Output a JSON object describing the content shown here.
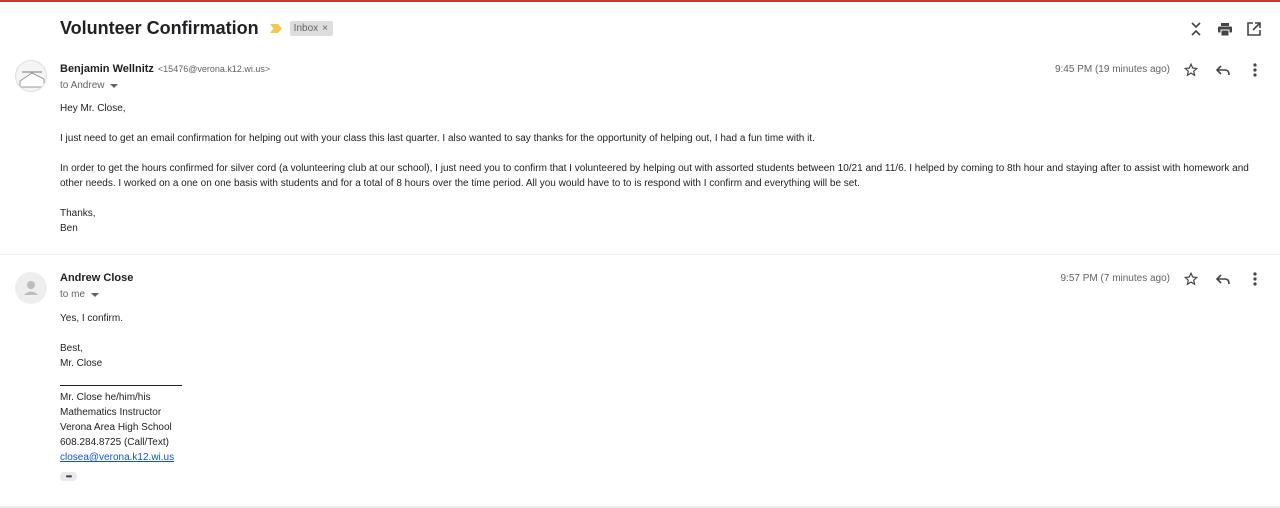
{
  "thread": {
    "subject": "Volunteer Confirmation",
    "label": "Inbox",
    "label_remove": "×"
  },
  "toolbar": {
    "icons": [
      "collapse-all-icon",
      "print-icon",
      "open-in-new-window-icon"
    ]
  },
  "messages": [
    {
      "sender_name": "Benjamin Wellnitz",
      "sender_email": "<15476@verona.k12.wi.us>",
      "to": "to Andrew",
      "time": "9:45 PM (19 minutes ago)",
      "body": [
        "Hey Mr. Close,",
        "I just need to get an email confirmation for helping out with your class this last quarter. I also wanted to say thanks for the opportunity of helping out, I had a fun time with it.",
        "In order to get the hours confirmed for silver cord (a volunteering club at our school), I just need you to confirm that I volunteered by helping out with assorted students between 10/21 and 11/6. I helped by coming to 8th hour and staying after to assist with homework and other needs. I worked on a one on one basis with students and for a total of 8 hours over the time period. All you would have to to is respond with I confirm and everything will be set.",
        "Thanks,",
        "Ben"
      ]
    },
    {
      "sender_name": "Andrew Close",
      "to": "to me",
      "time": "9:57 PM (7 minutes ago)",
      "body": [
        "Yes, I confirm.",
        "Best,",
        "Mr. Close"
      ],
      "signature": [
        "Mr. Close he/him/his",
        "Mathematics Instructor",
        "Verona Area High School",
        "608.284.8725 (Call/Text)"
      ],
      "signature_email": "closea@verona.k12.wi.us",
      "show_trimmed": "•••"
    }
  ],
  "colors": {
    "important_marker": "#f2c94c",
    "link": "#1155cc"
  }
}
